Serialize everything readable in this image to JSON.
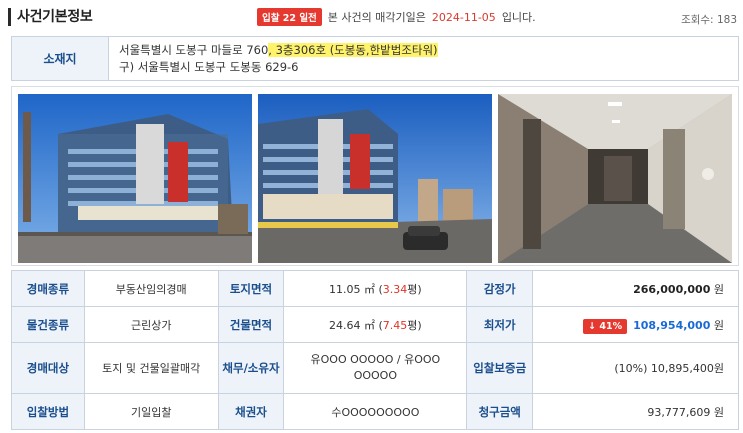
{
  "header": {
    "title": "사건기본정보",
    "dday_badge": "입찰 22 일전",
    "notice_prefix": "본 사건의 매각기일은",
    "sale_date": "2024-11-05",
    "notice_suffix": "입니다.",
    "views_label": "조회수:",
    "views_count": "183"
  },
  "address": {
    "label": "소재지",
    "line1_plain": "서울특별시 도봉구 마들로 760",
    "line1_highlight": ", 3층306호 (도봉동,한밭법조타워)",
    "line2": "구) 서울특별시 도봉구 도봉동 629-6"
  },
  "photos": [
    {
      "icon": "building-street-photo-1"
    },
    {
      "icon": "building-street-photo-2"
    },
    {
      "icon": "corridor-photo"
    }
  ],
  "info": {
    "auction_type_label": "경매종류",
    "auction_type": "부동산임의경매",
    "land_area_label": "토지면적",
    "land_area": "11.05 ㎡",
    "land_area_pyeong": "3.34",
    "pyeong_unit": "평",
    "appraisal_label": "감정가",
    "appraisal_value": "266,000,000",
    "won": "원",
    "property_type_label": "물건종류",
    "property_type": "근린상가",
    "building_area_label": "건물면적",
    "building_area": "24.64 ㎡",
    "building_area_pyeong": "7.45",
    "min_price_label": "최저가",
    "min_price_rate": "↓ 41%",
    "min_price_value": "108,954,000",
    "target_label": "경매대상",
    "target": "토지 및 건물일괄매각",
    "owner_label": "채무/소유자",
    "owner": "유OOO OOOOO / 유OOO OOOOO",
    "deposit_label": "입찰보증금",
    "deposit": "(10%) 10,895,400원",
    "method_label": "입찰방법",
    "method": "기일입찰",
    "creditor_label": "채권자",
    "creditor": "수OOOOOOOOO",
    "claim_label": "청구금액",
    "claim": "93,777,609 원"
  },
  "colors": {
    "label_bg": "#eef3f9",
    "label_text": "#1a4e8c",
    "accent_red": "#e5382f",
    "price_blue": "#1a6ad6",
    "highlight": "#fff36b"
  }
}
